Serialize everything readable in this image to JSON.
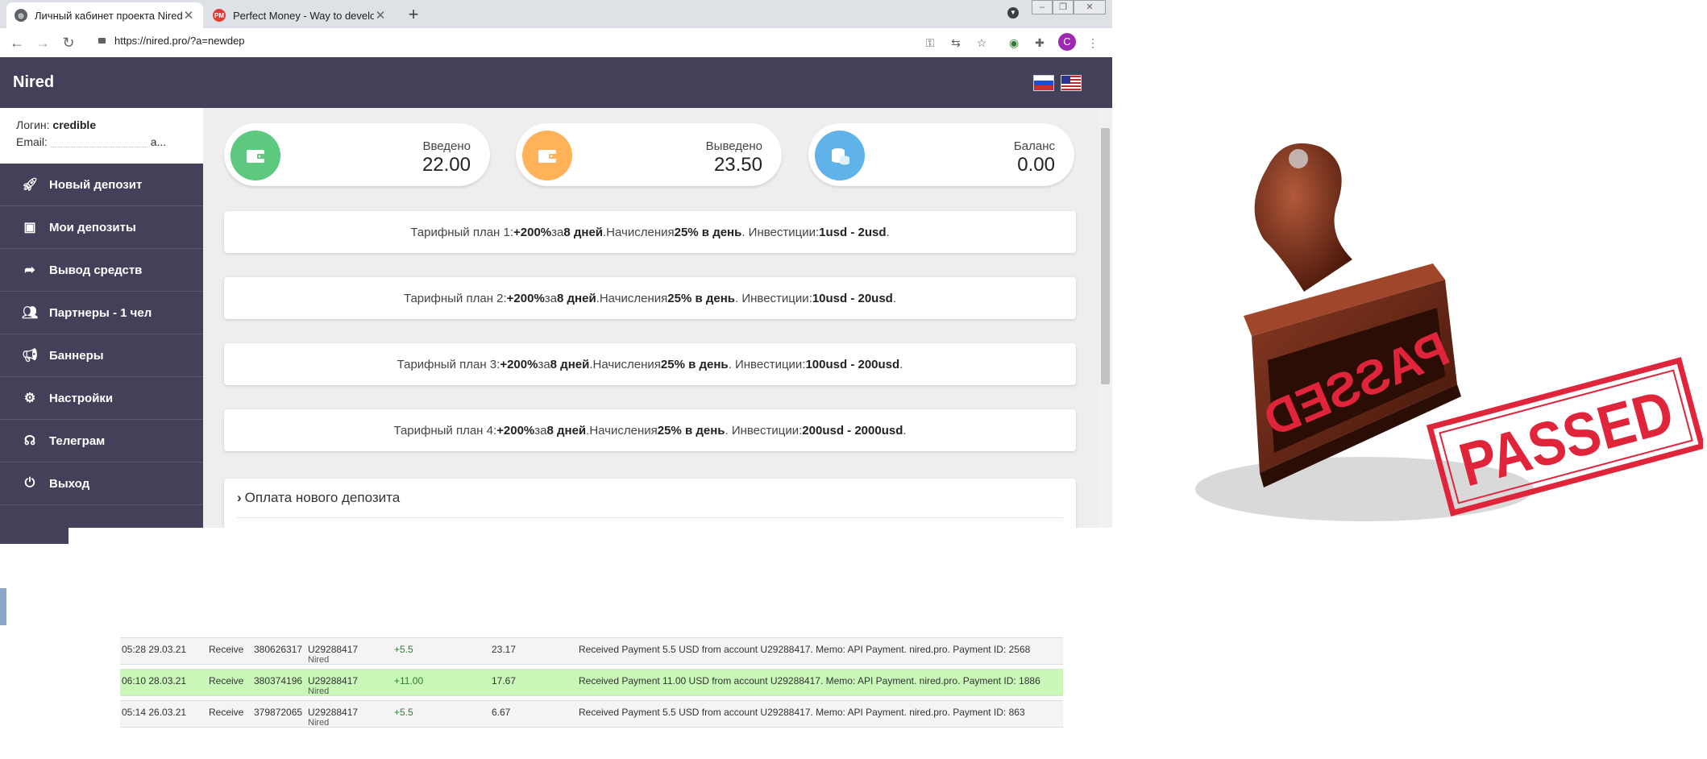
{
  "browser": {
    "tabs": [
      {
        "title": "Личный кабинет проекта Nired",
        "active": true
      },
      {
        "title": "Perfect Money - Way to develop",
        "active": false,
        "favicon_text": "PM"
      }
    ],
    "address": "https://nired.pro/?a=newdep",
    "profile_initial": "C"
  },
  "site": {
    "brand": "Nired",
    "user": {
      "login_label": "Логин:",
      "login_value": "credible",
      "email_label": "Email:",
      "email_value": "а..."
    },
    "menu": [
      {
        "label": "Новый депозит",
        "icon": "rocket-icon"
      },
      {
        "label": "Мои депозиты",
        "icon": "money-icon"
      },
      {
        "label": "Вывод средств",
        "icon": "share-icon"
      },
      {
        "label": "Партнеры - 1 чел",
        "icon": "users-icon"
      },
      {
        "label": "Баннеры",
        "icon": "megaphone-icon"
      },
      {
        "label": "Настройки",
        "icon": "gears-icon"
      },
      {
        "label": "Телеграм",
        "icon": "headset-icon"
      },
      {
        "label": "Выход",
        "icon": "power-icon"
      }
    ],
    "stats": [
      {
        "label": "Введено",
        "value": "22.00",
        "color": "#5dc97e",
        "icon": "wallet-icon"
      },
      {
        "label": "Выведено",
        "value": "23.50",
        "color": "#ffb258",
        "icon": "wallet-icon"
      },
      {
        "label": "Баланс",
        "value": "0.00",
        "color": "#5fb3e8",
        "icon": "coins-icon"
      }
    ],
    "plans": [
      {
        "prefix": "Тарифный план 1: ",
        "profit": "+200%",
        "za": " за ",
        "days": "8 дней",
        "accr_label": ".Начисления ",
        "accr": "25% в день",
        "inv_label": ". Инвестиции: ",
        "inv": "1usd - 2usd",
        "end": "."
      },
      {
        "prefix": "Тарифный план 2: ",
        "profit": "+200%",
        "za": " за ",
        "days": "8 дней",
        "accr_label": ".Начисления ",
        "accr": "25% в день",
        "inv_label": ". Инвестиции: ",
        "inv": "10usd - 20usd",
        "end": "."
      },
      {
        "prefix": "Тарифный план 3: ",
        "profit": "+200%",
        "za": " за ",
        "days": "8 дней",
        "accr_label": ".Начисления ",
        "accr": "25% в день",
        "inv_label": ". Инвестиции: ",
        "inv": "100usd - 200usd",
        "end": "."
      },
      {
        "prefix": "Тарифный план 4: ",
        "profit": "+200%",
        "za": " за ",
        "days": "8 дней",
        "accr_label": ".Начисления ",
        "accr": "25% в день",
        "inv_label": ". Инвестиции: ",
        "inv": "200usd - 2000usd",
        "end": "."
      }
    ],
    "payment_title": "Оплата нового депозита"
  },
  "stamp": {
    "handle_text": "PASSED",
    "imprint_text": "PASSED"
  },
  "transactions": [
    {
      "time": "05:28 29.03.21",
      "type": "Receive",
      "batch": "380626317",
      "account": "U29288417",
      "account_name": "Nired",
      "amount": "+5.5",
      "balance": "23.17",
      "memo": "Received Payment 5.5 USD from account U29288417. Memo: API Payment. nired.pro. Payment ID: 2568",
      "highlight": false
    },
    {
      "time": "06:10 28.03.21",
      "type": "Receive",
      "batch": "380374196",
      "account": "U29288417",
      "account_name": "Nired",
      "amount": "+11.00",
      "balance": "17.67",
      "memo": "Received Payment 11.00 USD from account U29288417. Memo: API Payment. nired.pro. Payment ID: 1886",
      "highlight": true
    },
    {
      "time": "05:14 26.03.21",
      "type": "Receive",
      "batch": "379872065",
      "account": "U29288417",
      "account_name": "Nired",
      "amount": "+5.5",
      "balance": "6.67",
      "memo": "Received Payment 5.5 USD from account U29288417. Memo: API Payment. nired.pro. Payment ID: 863",
      "highlight": false
    }
  ]
}
